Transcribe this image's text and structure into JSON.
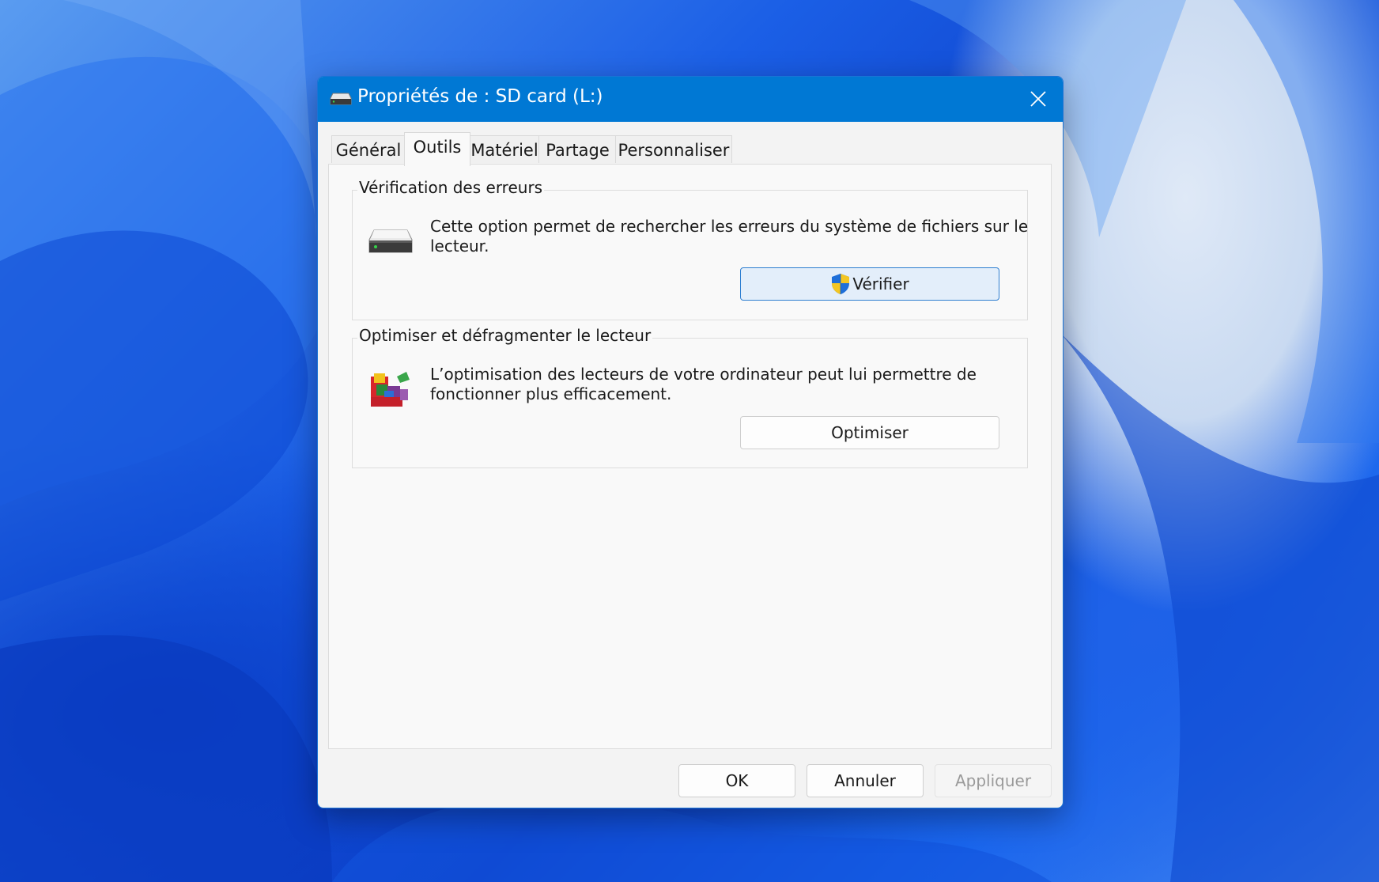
{
  "window": {
    "title": "Propriétés de : SD card (L:)",
    "close_label": "Fermer"
  },
  "tabs": [
    {
      "label": "Général",
      "active": false
    },
    {
      "label": "Outils",
      "active": true
    },
    {
      "label": "Matériel",
      "active": false
    },
    {
      "label": "Partage",
      "active": false
    },
    {
      "label": "Personnaliser",
      "active": false
    }
  ],
  "error_check": {
    "title": "Vérification des erreurs",
    "description_line1": "Cette option permet de rechercher les erreurs du système de fichiers sur le",
    "description_line2": "lecteur.",
    "button": "Vérifier",
    "icon": "drive-icon"
  },
  "optimize": {
    "title": "Optimiser et défragmenter le lecteur",
    "description_line1": "L’optimisation des lecteurs de votre ordinateur peut lui permettre de",
    "description_line2": "fonctionner plus efficacement.",
    "button": "Optimiser",
    "icon": "defrag-icon"
  },
  "footer": {
    "ok": "OK",
    "cancel": "Annuler",
    "apply": "Appliquer",
    "apply_enabled": false
  },
  "colors": {
    "titlebar": "#0078d4",
    "primary_button_border": "#2f7fd1"
  }
}
